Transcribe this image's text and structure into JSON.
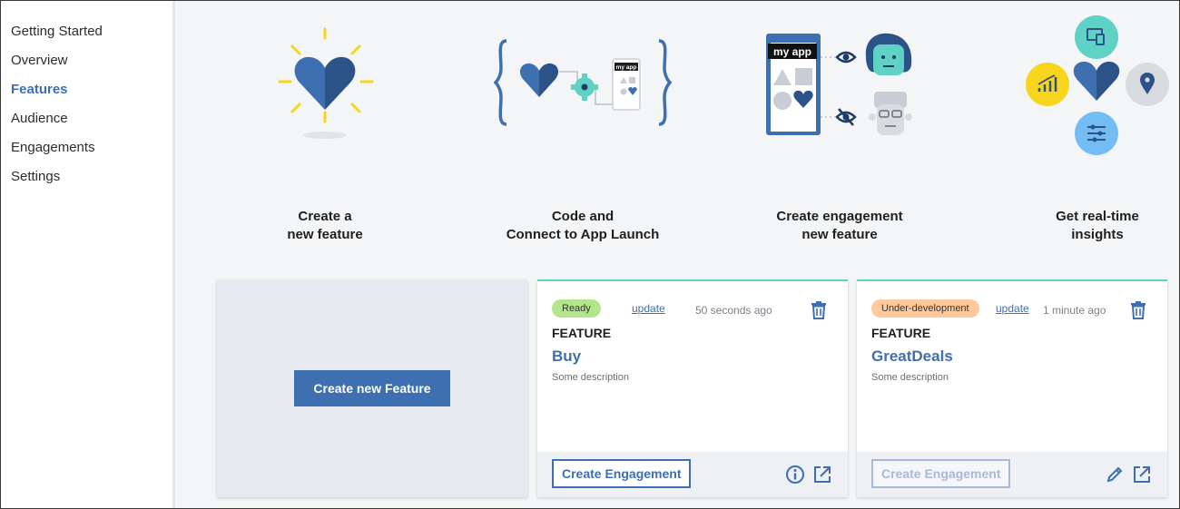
{
  "sidebar": {
    "items": [
      {
        "label": "Getting Started"
      },
      {
        "label": "Overview"
      },
      {
        "label": "Features",
        "active": true
      },
      {
        "label": "Audience"
      },
      {
        "label": "Engagements"
      },
      {
        "label": "Settings"
      }
    ]
  },
  "steps": [
    {
      "line1": "Create a",
      "line2": "new feature"
    },
    {
      "line1": "Code and",
      "line2": "Connect to App Launch"
    },
    {
      "line1": "Create engagement",
      "line2": "new feature"
    },
    {
      "line1": "Get real-time",
      "line2": "insights"
    }
  ],
  "illustration": {
    "app_label": "my app",
    "phone_label": "my app"
  },
  "create_card": {
    "button_label": "Create new Feature"
  },
  "features": [
    {
      "status": "Ready",
      "update_label": "update",
      "time": "50 seconds ago",
      "type_label": "FEATURE",
      "name": "Buy",
      "description": "Some description",
      "engagement_label": "Create Engagement"
    },
    {
      "status": "Under-development",
      "update_label": "update",
      "time": "1 minute ago",
      "type_label": "FEATURE",
      "name": "GreatDeals",
      "description": "Some description",
      "engagement_label": "Create Engagement"
    }
  ],
  "colors": {
    "accent": "#3e6fb0",
    "teal": "#5fd1c5",
    "ready": "#b3e58a",
    "under_development": "#ffc99b",
    "heart_yellow_rays": "#f7d51d"
  }
}
